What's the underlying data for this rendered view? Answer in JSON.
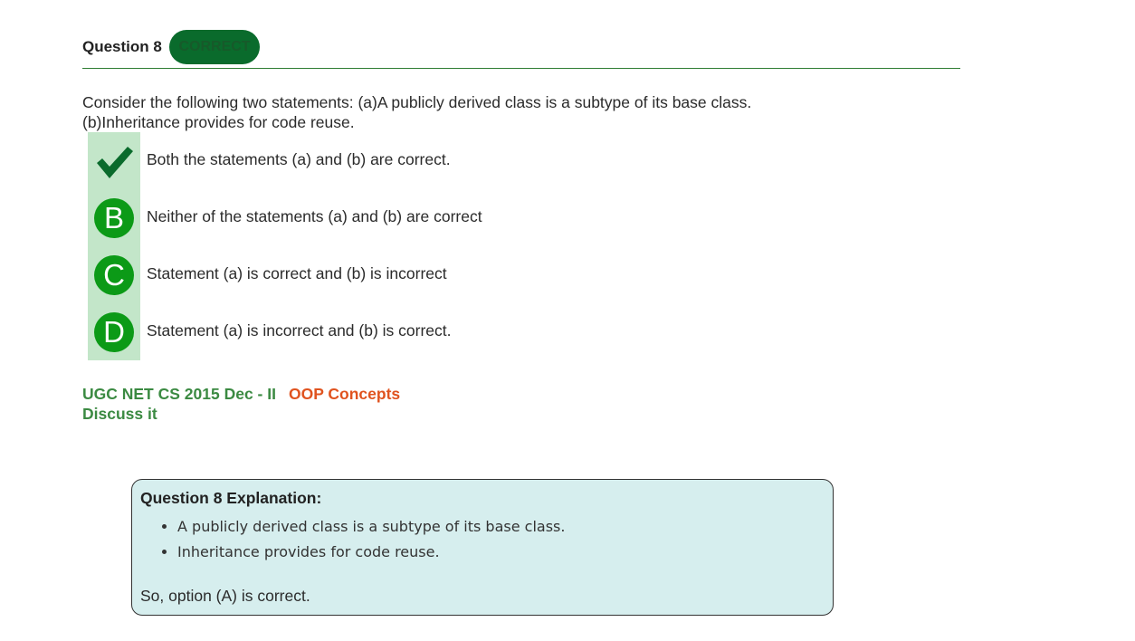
{
  "question": {
    "title": "Question 8",
    "status_badge": "CORRECT",
    "text_line1": "Consider the following two statements: (a)A publicly derived class is a subtype of its base class.",
    "text_line2": "(b)Inheritance provides for code reuse."
  },
  "options": [
    {
      "marker": "check-icon",
      "letter": "A",
      "text": "Both the statements (a) and (b) are correct.",
      "selected": true
    },
    {
      "marker": "letter",
      "letter": "B",
      "text": "Neither of the statements (a) and (b) are correct"
    },
    {
      "marker": "letter",
      "letter": "C",
      "text": "Statement (a) is correct and (b) is incorrect"
    },
    {
      "marker": "letter",
      "letter": "D",
      "text": "Statement (a) is incorrect and (b) is correct."
    }
  ],
  "tags": {
    "exam": "UGC NET CS 2015 Dec - II",
    "topic": "OOP Concepts",
    "discuss": "Discuss it"
  },
  "explanation": {
    "title": "Question 8 Explanation:",
    "points": [
      "A publicly derived class is a subtype of its base class.",
      "Inheritance provides for code reuse."
    ],
    "conclusion": "So, option (A) is correct."
  },
  "colors": {
    "badge_bg": "#0a6b2c",
    "option_strip_bg": "#c3e6c9",
    "letter_circle": "#0c9a17",
    "checkmark": "#0a6b2c",
    "exam_tag": "#3b8a42",
    "topic_tag": "#e0531f",
    "explanation_bg": "#d6eeee"
  }
}
